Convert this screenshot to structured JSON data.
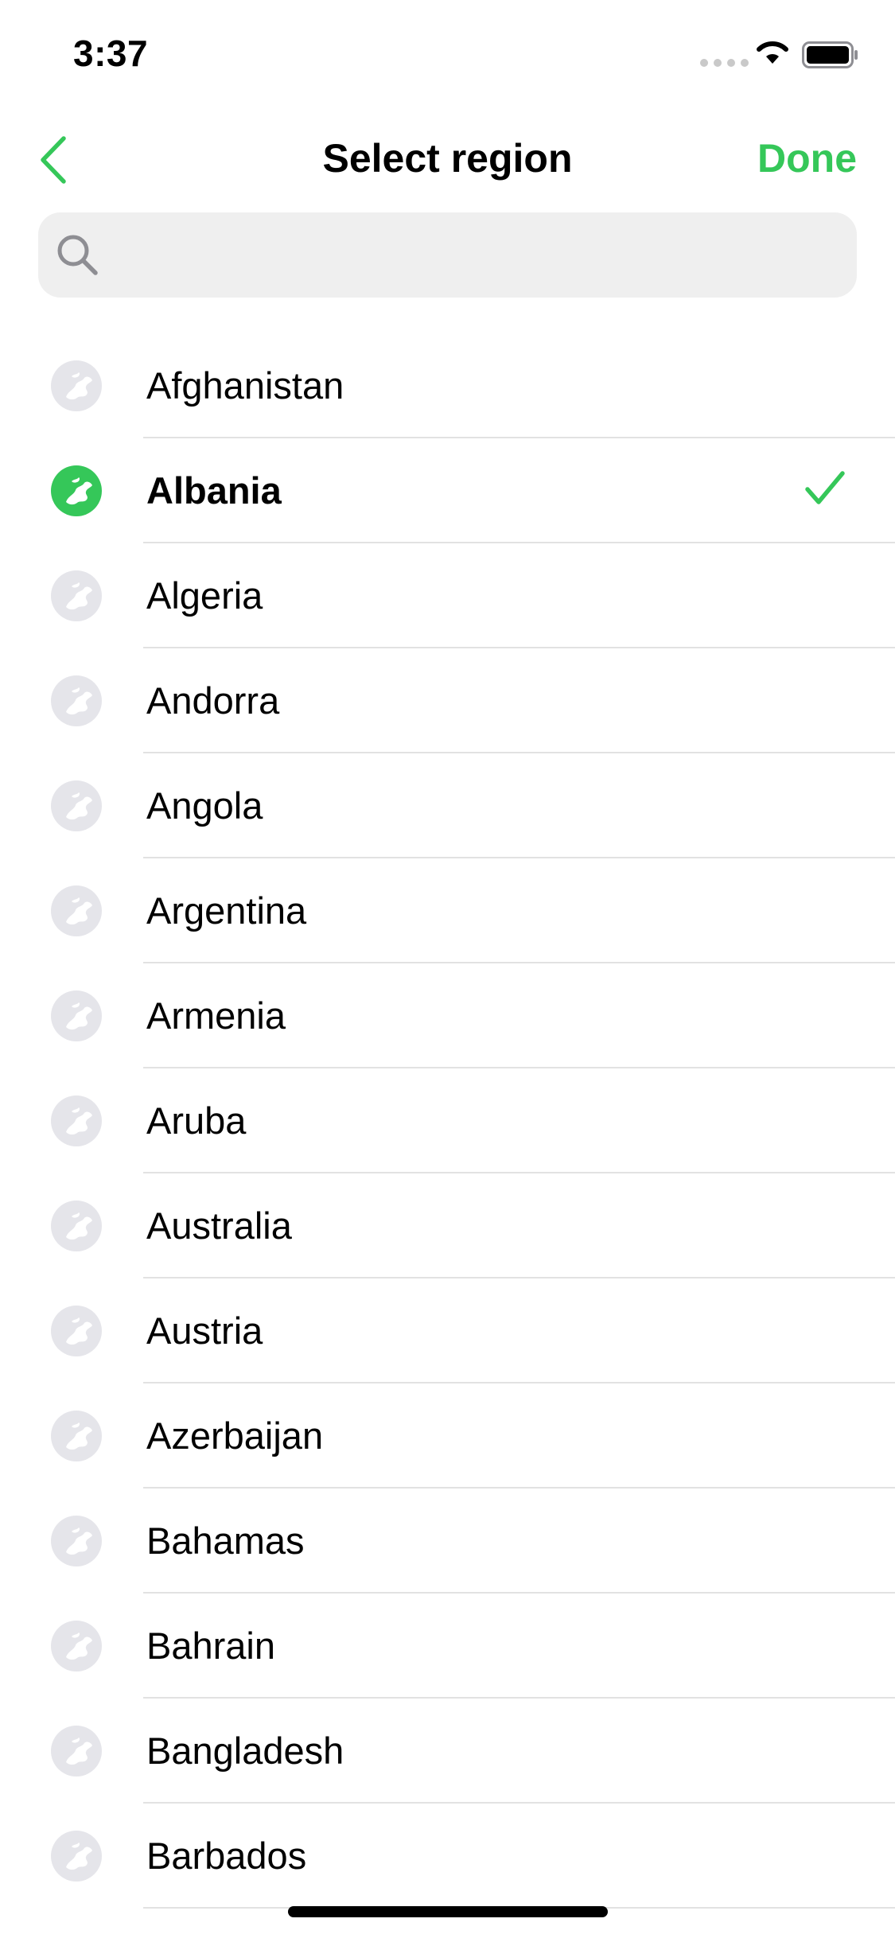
{
  "status_bar": {
    "time": "3:37"
  },
  "nav": {
    "back_icon": "chevron-left-icon",
    "title": "Select region",
    "done_label": "Done"
  },
  "search": {
    "placeholder": "",
    "value": "",
    "icon": "search-icon"
  },
  "regions": [
    {
      "name": "Afghanistan",
      "selected": false
    },
    {
      "name": "Albania",
      "selected": true
    },
    {
      "name": "Algeria",
      "selected": false
    },
    {
      "name": "Andorra",
      "selected": false
    },
    {
      "name": "Angola",
      "selected": false
    },
    {
      "name": "Argentina",
      "selected": false
    },
    {
      "name": "Armenia",
      "selected": false
    },
    {
      "name": "Aruba",
      "selected": false
    },
    {
      "name": "Australia",
      "selected": false
    },
    {
      "name": "Austria",
      "selected": false
    },
    {
      "name": "Azerbaijan",
      "selected": false
    },
    {
      "name": "Bahamas",
      "selected": false
    },
    {
      "name": "Bahrain",
      "selected": false
    },
    {
      "name": "Bangladesh",
      "selected": false
    },
    {
      "name": "Barbados",
      "selected": false
    }
  ],
  "colors": {
    "accent": "#35c759",
    "globe_inactive": "#e5e5ea",
    "divider": "#e2e2e2",
    "search_bg": "#efefef"
  }
}
